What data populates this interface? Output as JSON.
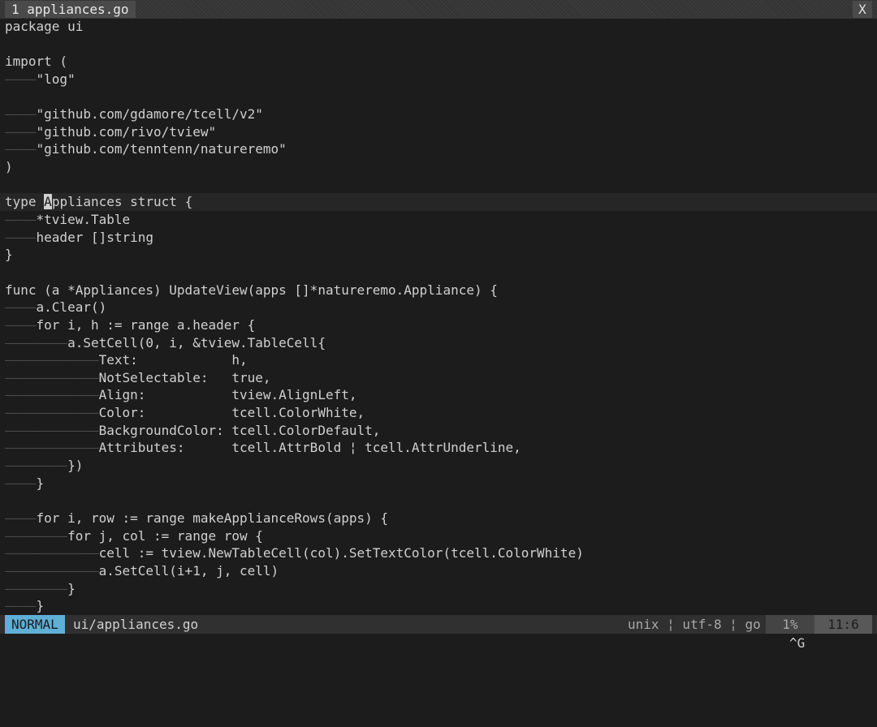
{
  "tabline": {
    "active_tab": "1 appliances.go",
    "close_label": "X"
  },
  "editor": {
    "cursor_line": 11,
    "cursor_col": 5,
    "lines": [
      {
        "indent": "",
        "text": "package ui"
      },
      {
        "indent": "",
        "text": ""
      },
      {
        "indent": "",
        "text": "import ("
      },
      {
        "indent": "––––",
        "text": "\"log\""
      },
      {
        "indent": "",
        "text": ""
      },
      {
        "indent": "––––",
        "text": "\"github.com/gdamore/tcell/v2\""
      },
      {
        "indent": "––––",
        "text": "\"github.com/rivo/tview\""
      },
      {
        "indent": "––––",
        "text": "\"github.com/tenntenn/natureremo\""
      },
      {
        "indent": "",
        "text": ")"
      },
      {
        "indent": "",
        "text": ""
      },
      {
        "indent": "",
        "text": "type Appliances struct {"
      },
      {
        "indent": "––––",
        "text": "*tview.Table"
      },
      {
        "indent": "––––",
        "text": "header []string"
      },
      {
        "indent": "",
        "text": "}"
      },
      {
        "indent": "",
        "text": ""
      },
      {
        "indent": "",
        "text": "func (a *Appliances) UpdateView(apps []*natureremo.Appliance) {"
      },
      {
        "indent": "––––",
        "text": "a.Clear()"
      },
      {
        "indent": "––––",
        "text": "for i, h := range a.header {"
      },
      {
        "indent": "––––––––",
        "text": "a.SetCell(0, i, &tview.TableCell{"
      },
      {
        "indent": "––––––––––––",
        "text": "Text:            h,"
      },
      {
        "indent": "––––––––––––",
        "text": "NotSelectable:   true,"
      },
      {
        "indent": "––––––––––––",
        "text": "Align:           tview.AlignLeft,"
      },
      {
        "indent": "––––––––––––",
        "text": "Color:           tcell.ColorWhite,"
      },
      {
        "indent": "––––––––––––",
        "text": "BackgroundColor: tcell.ColorDefault,"
      },
      {
        "indent": "––––––––––––",
        "text": "Attributes:      tcell.AttrBold ¦ tcell.AttrUnderline,"
      },
      {
        "indent": "––––––––",
        "text": "})"
      },
      {
        "indent": "––––",
        "text": "}"
      },
      {
        "indent": "",
        "text": ""
      },
      {
        "indent": "––––",
        "text": "for i, row := range makeApplianceRows(apps) {"
      },
      {
        "indent": "––––––––",
        "text": "for j, col := range row {"
      },
      {
        "indent": "––––––––––––",
        "text": "cell := tview.NewTableCell(col).SetTextColor(tcell.ColorWhite)"
      },
      {
        "indent": "––––––––––––",
        "text": "a.SetCell(i+1, j, cell)"
      },
      {
        "indent": "––––––––",
        "text": "}"
      },
      {
        "indent": "––––",
        "text": "}"
      }
    ]
  },
  "statusline": {
    "mode": "NORMAL",
    "filename": "ui/appliances.go",
    "fileinfo": "unix ¦ utf-8 ¦ go",
    "percent": "1%",
    "position": "11:6"
  },
  "cmdline": {
    "showcmd": "^G"
  },
  "colors": {
    "background": "#1c1c1c",
    "text": "#d0d0d0",
    "mode_accent": "#5fafd7",
    "indent_guide": "#4a4a4a"
  }
}
